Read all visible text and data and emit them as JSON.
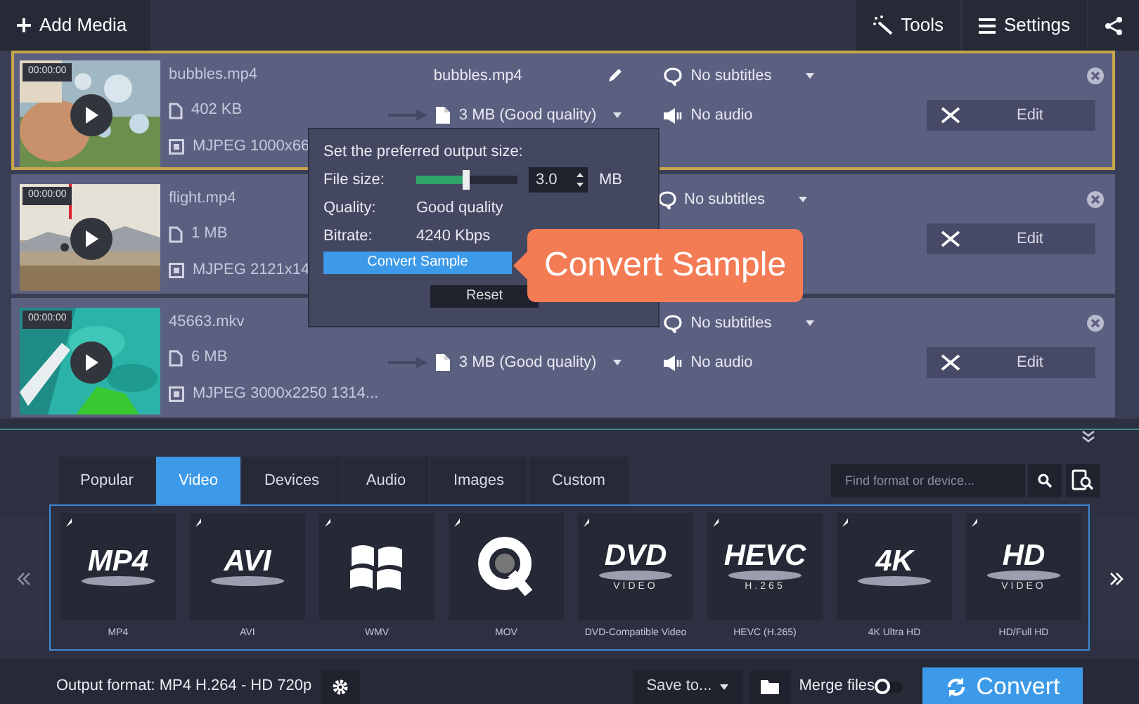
{
  "toolbar": {
    "add_media": "Add Media",
    "tools": "Tools",
    "settings": "Settings"
  },
  "files": [
    {
      "time": "00:00:00",
      "name": "bubbles.mp4",
      "size": "402 KB",
      "codec": "MJPEG 1000x66",
      "output_name": "bubbles.mp4",
      "output_size": "3 MB (Good quality)",
      "subtitles": "No subtitles",
      "audio": "No audio",
      "edit": "Edit",
      "selected": true
    },
    {
      "time": "00:00:00",
      "name": "flight.mp4",
      "size": "1 MB",
      "codec": "MJPEG 2121x14",
      "subtitles": "No subtitles",
      "edit": "Edit",
      "selected": false
    },
    {
      "time": "00:00:00",
      "name": "45663.mkv",
      "size": "6 MB",
      "codec": "MJPEG 3000x2250 1314...",
      "output_size": "3 MB (Good quality)",
      "subtitles": "No subtitles",
      "audio": "No audio",
      "edit": "Edit",
      "selected": false
    }
  ],
  "size_popup": {
    "title": "Set the preferred output size:",
    "fields": [
      {
        "kind": "slider",
        "label": "File size:",
        "level": 0.48,
        "value": "3.0",
        "unit": "MB"
      },
      {
        "kind": "text",
        "label": "Quality:",
        "value": "Good quality"
      },
      {
        "kind": "text",
        "label": "Bitrate:",
        "value": "4240 Kbps"
      }
    ],
    "convert_sample": "Convert Sample",
    "reset": "Reset"
  },
  "callout": {
    "text": "Convert Sample"
  },
  "format_tabs": [
    {
      "label": "Popular",
      "selected": false
    },
    {
      "label": "Video",
      "selected": true
    },
    {
      "label": "Devices",
      "selected": false
    },
    {
      "label": "Audio",
      "selected": false
    },
    {
      "label": "Images",
      "selected": false
    },
    {
      "label": "Custom",
      "selected": false
    }
  ],
  "format_search": {
    "placeholder": "Find format or device..."
  },
  "formats": [
    {
      "kind": "logo",
      "logo": "MP4",
      "label": "MP4"
    },
    {
      "kind": "logo",
      "logo": "AVI",
      "label": "AVI"
    },
    {
      "kind": "windows",
      "label": "WMV"
    },
    {
      "kind": "quicktime",
      "label": "MOV"
    },
    {
      "kind": "logo",
      "logo": "DVD",
      "sub": "VIDEO",
      "label": "DVD-Compatible Video"
    },
    {
      "kind": "logo",
      "logo": "HEVC",
      "sub": "H.265",
      "label": "HEVC (H.265)"
    },
    {
      "kind": "logo",
      "logo": "4K",
      "label": "4K Ultra HD"
    },
    {
      "kind": "logo",
      "logo": "HD",
      "sub": "VIDEO",
      "label": "HD/Full HD"
    }
  ],
  "bottom_bar": {
    "output_format": "Output format: MP4 H.264 - HD 720p",
    "save_to": "Save to...",
    "merge_files": "Merge files",
    "merge_on": false,
    "convert": "Convert"
  }
}
